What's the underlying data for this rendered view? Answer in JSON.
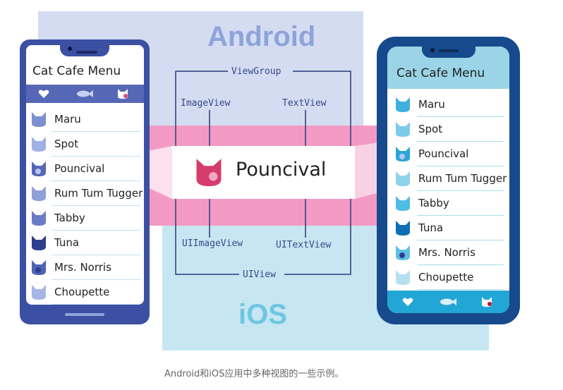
{
  "platforms": {
    "android": "Android",
    "ios": "iOS"
  },
  "android_phone": {
    "title": "Cat Cafe Menu",
    "tabs": [
      {
        "icon": "heart-icon"
      },
      {
        "icon": "fish-icon"
      },
      {
        "icon": "cat-icon"
      }
    ],
    "cats": [
      {
        "name": "Maru"
      },
      {
        "name": "Spot"
      },
      {
        "name": "Pouncival"
      },
      {
        "name": "Rum Tum Tugger"
      },
      {
        "name": "Tabby"
      },
      {
        "name": "Tuna"
      },
      {
        "name": "Mrs. Norris"
      },
      {
        "name": "Choupette"
      }
    ]
  },
  "ios_phone": {
    "title": "Cat Cafe Menu",
    "tabs": [
      {
        "icon": "heart-icon"
      },
      {
        "icon": "fish-icon"
      },
      {
        "icon": "cat-icon"
      }
    ],
    "cats": [
      {
        "name": "Maru"
      },
      {
        "name": "Spot"
      },
      {
        "name": "Pouncival"
      },
      {
        "name": "Rum Tum Tugger"
      },
      {
        "name": "Tabby"
      },
      {
        "name": "Tuna"
      },
      {
        "name": "Mrs. Norris"
      },
      {
        "name": "Choupette"
      }
    ]
  },
  "views": {
    "android_container": "ViewGroup",
    "android_image": "ImageView",
    "android_text": "TextView",
    "ios_container": "UIView",
    "ios_image": "UIImageView",
    "ios_text": "UITextView"
  },
  "featured": {
    "name": "Pouncival",
    "icon": "cat-icon"
  },
  "caption": "Android和iOS应用中多种视图的一些示例。",
  "colors": {
    "android_band": "#d3dcf1",
    "ios_band": "#c6e6f2",
    "pink_band": "#f29ac4",
    "android_phone": "#3b4fa3",
    "ios_phone": "#164a8c",
    "ios_header": "#9ad4e6",
    "featured_cat": "#d63c6c"
  }
}
